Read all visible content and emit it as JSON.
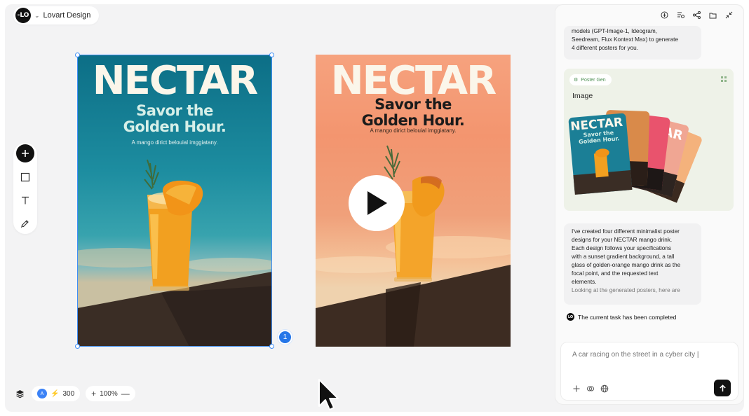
{
  "header": {
    "app_name": "Lovart Design",
    "logo_text": "-LO"
  },
  "toolbar": {
    "tools": [
      "add-icon",
      "rectangle-icon",
      "text-icon",
      "pen-icon"
    ]
  },
  "canvas": {
    "poster1": {
      "title": "NECTAR",
      "subtitle_line1": "Savor the",
      "subtitle_line2": "Golden Hour.",
      "tagline": "A mango dirict belouial imggiatany."
    },
    "poster2": {
      "title": "NECTAR",
      "subtitle_line1": "Savor the",
      "subtitle_line2": "Golden Hour.",
      "tagline": "A mango dirict belouial imggiatany."
    },
    "selection_count": "1"
  },
  "bottom_bar": {
    "avatar_letter": "A",
    "credits": "300",
    "zoom": "100%",
    "zoom_in": "+",
    "zoom_out": "—"
  },
  "chat": {
    "msg1_line1": "models (GPT-Image-1, Ideogram,",
    "msg1_line2": "Seedream, Flux Kontext Max) to generate",
    "msg1_line3": "4 different posters for you.",
    "card_chip": "Poster Gen",
    "card_title": "Image",
    "card_thumb_title": "NECTAR",
    "card_thumb_sub1": "Savor the",
    "card_thumb_sub2": "Golden Hour.",
    "card_back_text": "AR",
    "msg2_lines": [
      "I've created four different minimalist poster",
      "designs for your NECTAR mango drink.",
      "Each design follows your specifications",
      "with a sunset gradient background, a tall",
      "glass of golden-orange mango drink as the",
      "focal point, and the requested text",
      "elements.",
      "Looking at the generated posters, here are"
    ],
    "status": "The current task has been completed",
    "composer_placeholder": "A car racing on the street in a cyber city |"
  },
  "colors": {
    "accent": "#2576e8",
    "poster1_bg": "#0c6e86",
    "poster2_bg": "#f6a27e",
    "chip_text": "#4c8f52"
  }
}
